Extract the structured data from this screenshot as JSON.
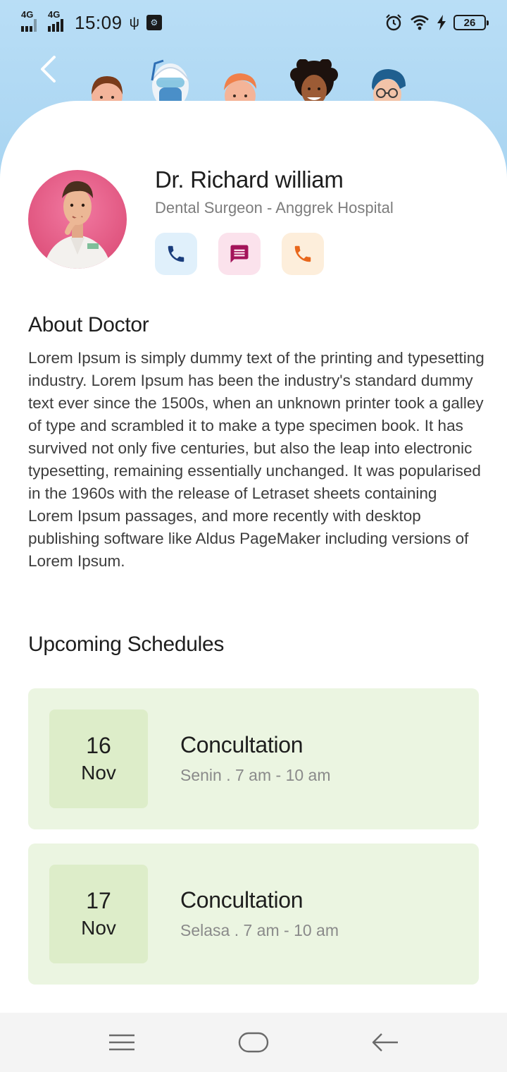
{
  "status_bar": {
    "network1": "4G",
    "network2": "4G",
    "time": "15:09",
    "battery": "26",
    "icons": [
      "usb-icon",
      "usb-debug-icon",
      "alarm-icon",
      "wifi-icon",
      "charging-icon",
      "battery-icon"
    ]
  },
  "header": {
    "back_icon": "chevron-left-icon",
    "avatars": [
      "avatar-brown-hair",
      "avatar-medical-mask",
      "avatar-orange-hair",
      "avatar-curly-hair",
      "avatar-glasses"
    ]
  },
  "doctor": {
    "name": "Dr. Richard william",
    "specialty": "Dental Surgeon - Anggrek Hospital",
    "actions": [
      {
        "icon": "phone-icon",
        "color": "#1a3d7c",
        "bg": "#e0f0fb"
      },
      {
        "icon": "message-icon",
        "color": "#a3145a",
        "bg": "#fbe2ec"
      },
      {
        "icon": "phone-icon",
        "color": "#e8671c",
        "bg": "#fdeedb"
      }
    ]
  },
  "about": {
    "title": "About Doctor",
    "text": "Lorem Ipsum is simply dummy text of the printing and typesetting industry. Lorem Ipsum has been the industry's standard dummy text ever since the 1500s, when an unknown printer took a galley of type and scrambled it to make a type specimen book. It has survived not only five centuries, but also the leap into electronic typesetting, remaining essentially unchanged. It was popularised in the 1960s with the release of Letraset sheets containing Lorem Ipsum passages, and more recently with desktop publishing software like Aldus PageMaker including versions of Lorem Ipsum."
  },
  "schedules": {
    "title": "Upcoming Schedules",
    "items": [
      {
        "day": "16",
        "month": "Nov",
        "title": "Concultation",
        "subtitle": "Senin . 7 am - 10 am"
      },
      {
        "day": "17",
        "month": "Nov",
        "title": "Concultation",
        "subtitle": "Selasa . 7 am - 10 am"
      }
    ]
  },
  "nav": {
    "icons": [
      "menu-icon",
      "home-icon",
      "back-arrow-icon"
    ]
  },
  "colors": {
    "header_bg": "#b9def6",
    "card_bg": "#ebf5e1",
    "date_bg": "#ddedc9"
  }
}
